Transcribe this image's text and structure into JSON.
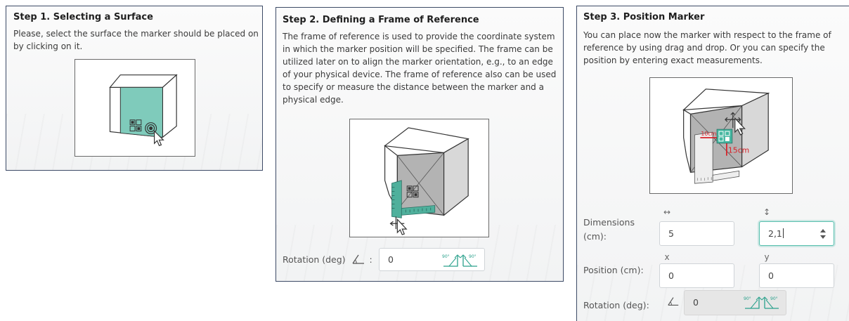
{
  "colors": {
    "accent": "#58c0ae",
    "marker_green": "#7fcbbb",
    "measure_red": "#d8232a",
    "border": "#3c4a66"
  },
  "step1": {
    "title": "Step 1. Selecting a Surface",
    "description": "Please, select the surface the marker should be placed on by clicking on it."
  },
  "step2": {
    "title": "Step 2. Defining a Frame of Reference",
    "description": "The frame of reference is used to provide the coordinate system in which the marker position will be specified. The frame can be utilized later on to align the marker orientation, e.g., to an edge of your physical device. The frame of reference also can be used to specify or measure the distance between the marker and a physical edge.",
    "rotation_label": "Rotation (deg)",
    "rotation_colon": ":",
    "rotation_value": "0"
  },
  "step3": {
    "title": "Step 3. Position Marker",
    "description": "You can place now the marker with respect to the frame of reference by using drag and drop. Or you can specify the position by entering exact measurements.",
    "illustration_labels": {
      "horizontal": "10cm",
      "vertical": "15cm"
    },
    "dimensions_label": "Dimensions (cm):",
    "dimensions_width_symbol": "↔",
    "dimensions_height_symbol": "↕",
    "dimensions_width": "5",
    "dimensions_height": "2,1",
    "position_label": "Position (cm):",
    "position_x_label": "x",
    "position_y_label": "y",
    "position_x": "0",
    "position_y": "0",
    "rotation_label": "Rotation (deg):",
    "rotation_value": "0"
  },
  "rotate_buttons": {
    "counter_clockwise": "90°",
    "clockwise": "90°"
  },
  "icons": [
    "qr-marker-icon",
    "target-click-icon",
    "mouse-cursor-icon",
    "angle-icon",
    "rotate-left-90-icon",
    "rotate-right-90-icon",
    "spinner-arrows-icon",
    "ruler-icon"
  ]
}
